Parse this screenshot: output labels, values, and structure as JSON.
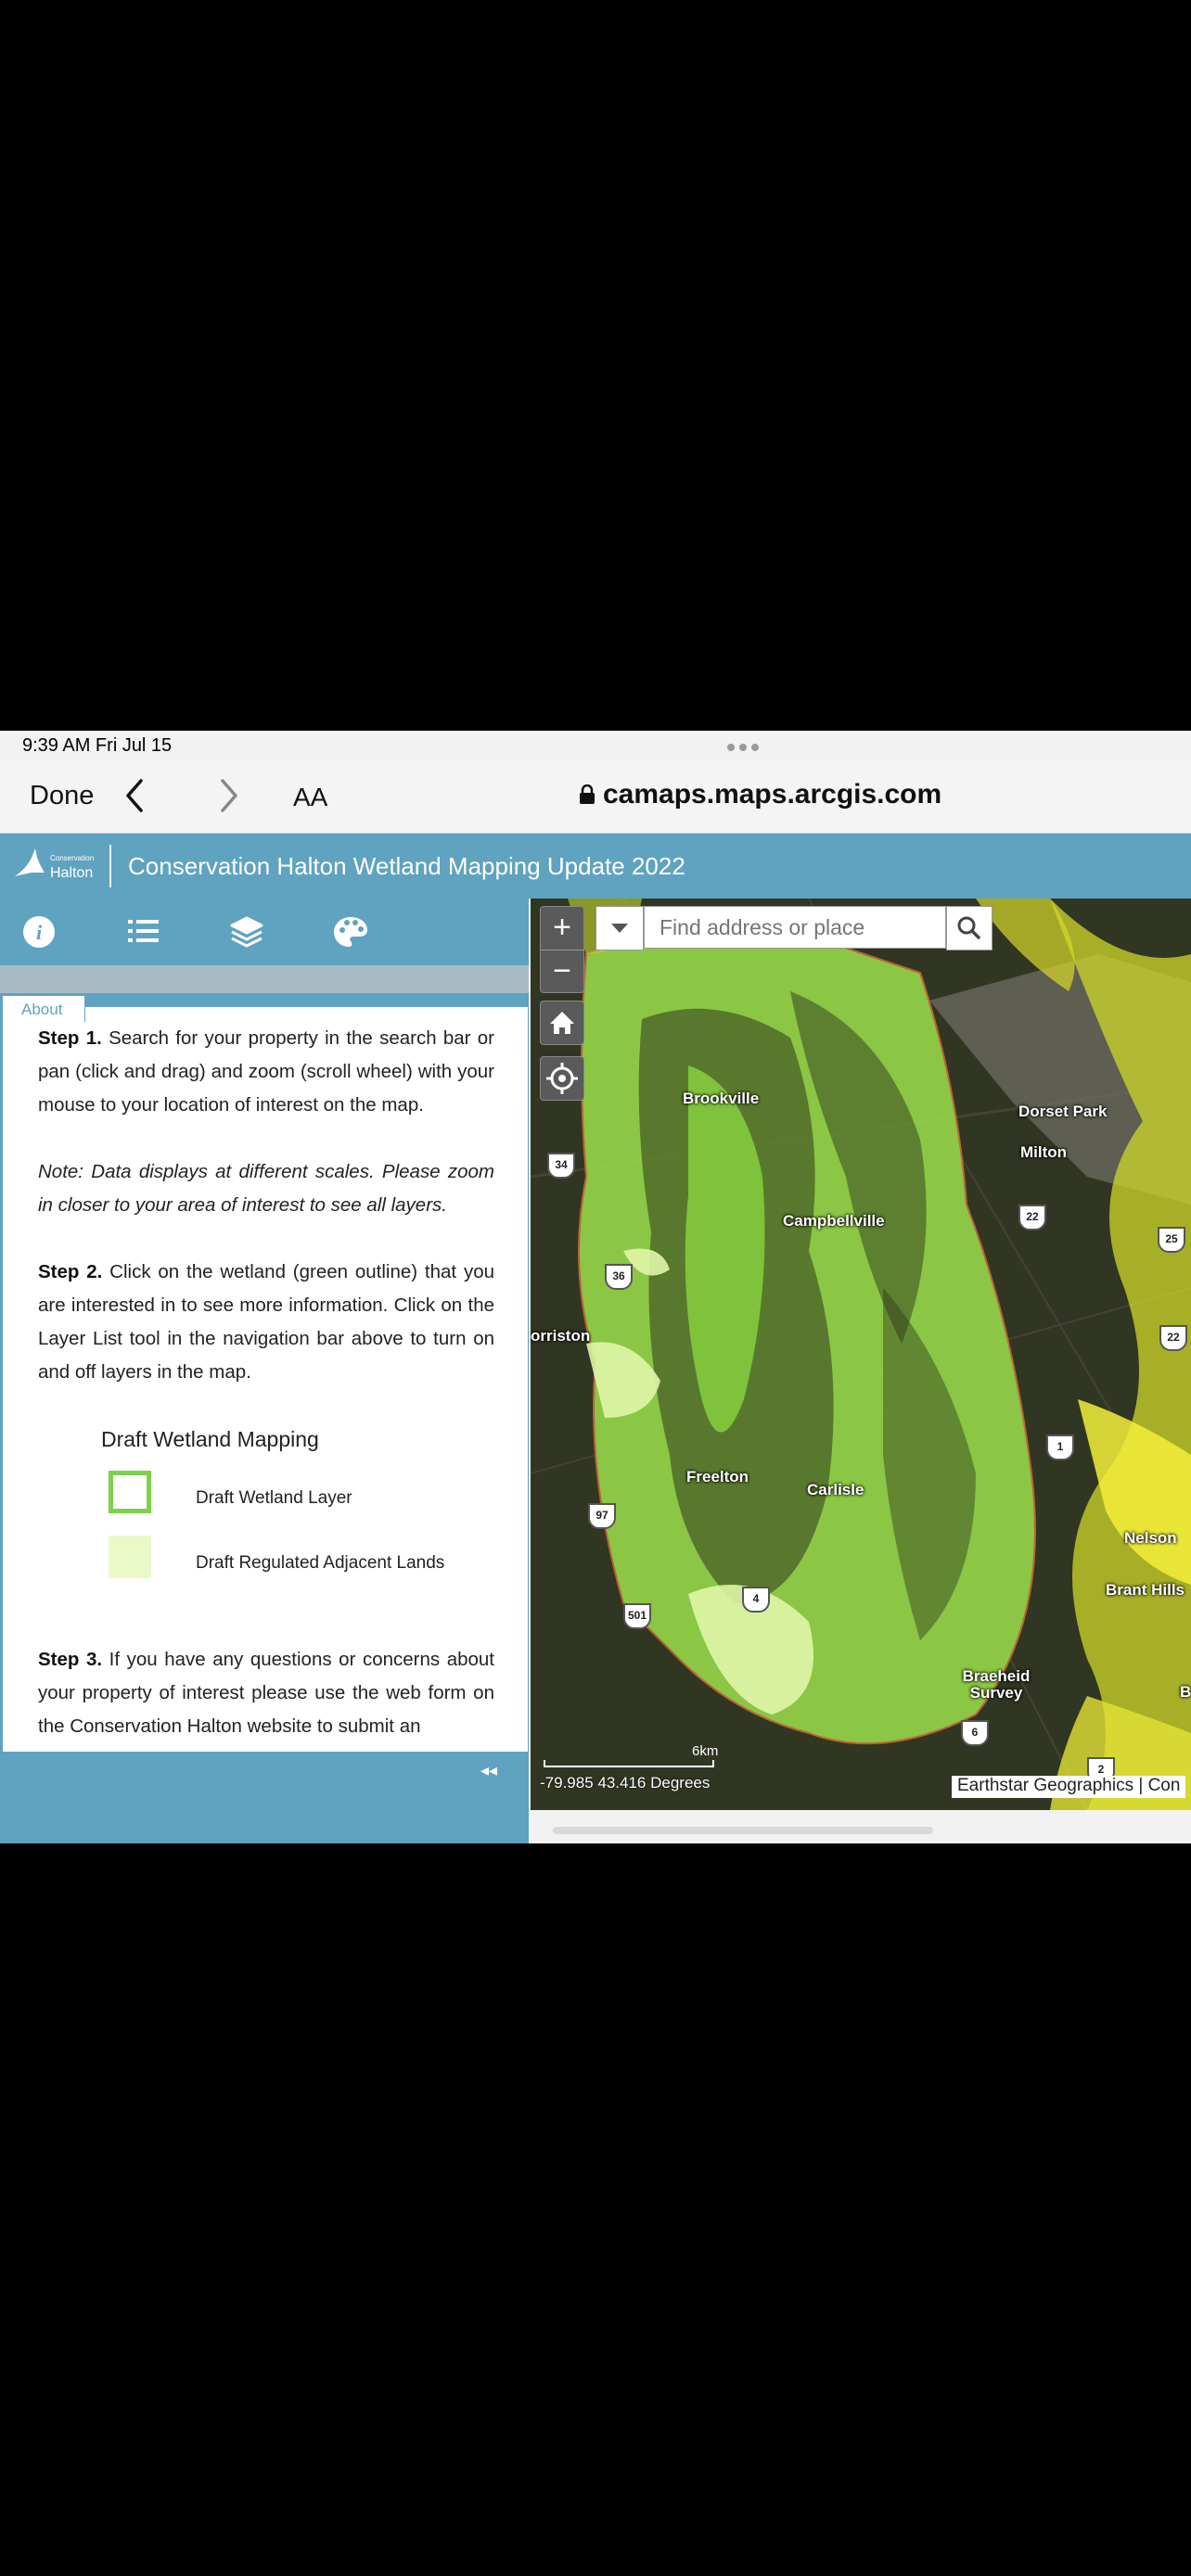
{
  "status_bar": {
    "time": "9:39 AM   Fri Jul 15"
  },
  "browser": {
    "done_label": "Done",
    "text_size_label": "AA",
    "url": "camaps.maps.arcgis.com"
  },
  "app": {
    "logo_small": "Conservation",
    "logo_large": "Halton",
    "title": "Conservation Halton Wetland Mapping Update 2022"
  },
  "nav_icons": [
    "info-icon",
    "list-icon",
    "layers-icon",
    "palette-icon"
  ],
  "panel": {
    "tab_label": "About",
    "step1_label": "Step 1.",
    "step1_text": " Search for your property in the search bar or pan (click and drag) and zoom (scroll wheel) with your mouse to your location of interest on the map.",
    "note_text": "Note: Data displays at different scales. Please zoom in closer to your area of interest to see all layers.",
    "step2_label": "Step 2.",
    "step2_text": " Click on the wetland (green outline) that you are interested in to see more information. Click on the Layer List tool in the navigation bar above to turn on and off layers in the map.",
    "legend_title": "Draft Wetland Mapping",
    "legend_items": [
      {
        "label": "Draft Wetland Layer",
        "color": "#7dd24a"
      },
      {
        "label": "Draft Regulated Adjacent Lands",
        "color": "#eaf9c8"
      }
    ],
    "step3_label": "Step 3.",
    "step3_text": " If you have any questions or concerns about your property of interest please use the web form on the Conservation Halton website to submit an",
    "collapse_label": "◂◂"
  },
  "map": {
    "search_placeholder": "Find address or place",
    "zoom_in": "+",
    "zoom_out": "−",
    "places": [
      "Brookville",
      "Dorset Park",
      "Milton",
      "Campbellville",
      "orriston",
      "Freelton",
      "Carlisle",
      "Nelson",
      "Brant Hills",
      "Braeheid Survey",
      "B"
    ],
    "highways": [
      "34",
      "22",
      "25",
      "36",
      "22",
      "1",
      "97",
      "4",
      "501",
      "6",
      "2"
    ],
    "scale_label": "6km",
    "coordinates": "-79.985 43.416 Degrees",
    "attribution": "Earthstar Geographics | Con"
  },
  "colors": {
    "header": "#5fa3c0",
    "wetland": "#7dd24a",
    "adjacent": "#eaf9c8"
  }
}
